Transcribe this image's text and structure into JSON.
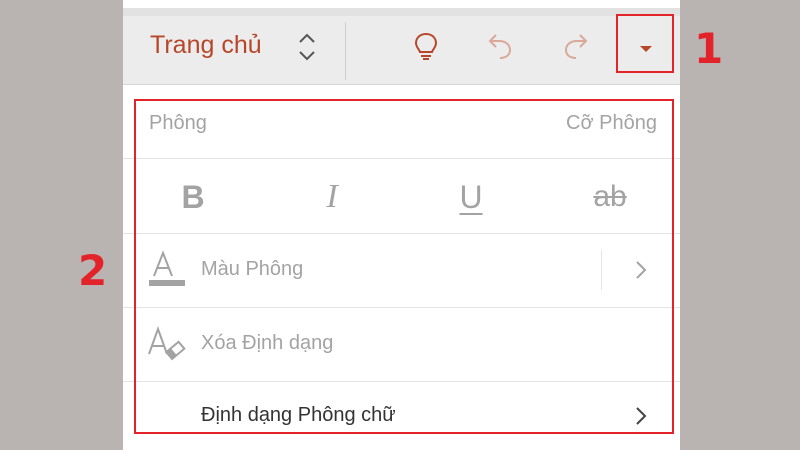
{
  "toolbar": {
    "tab_title": "Trang chủ",
    "tab_switch_icon": "chevron-up-down-icon",
    "buttons": [
      {
        "name": "lightbulb-icon"
      },
      {
        "name": "undo-icon"
      },
      {
        "name": "redo-icon"
      },
      {
        "name": "dropdown-triangle-icon"
      }
    ],
    "accent_color": "#b7472a"
  },
  "annotations": {
    "callout_1": "1",
    "callout_2": "2",
    "highlight_color": "#e2242a"
  },
  "font_panel": {
    "font_label": "Phông",
    "size_label": "Cỡ Phông",
    "styles": [
      {
        "label": "B",
        "name": "bold"
      },
      {
        "label": "I",
        "name": "italic"
      },
      {
        "label": "U",
        "name": "underline"
      },
      {
        "label": "ab",
        "name": "strikethrough"
      }
    ],
    "font_color_label": "Màu Phông",
    "clear_formatting_label": "Xóa Định dạng",
    "format_font_label": "Định dạng Phông chữ",
    "disabled_color": "#a3a3a3"
  }
}
